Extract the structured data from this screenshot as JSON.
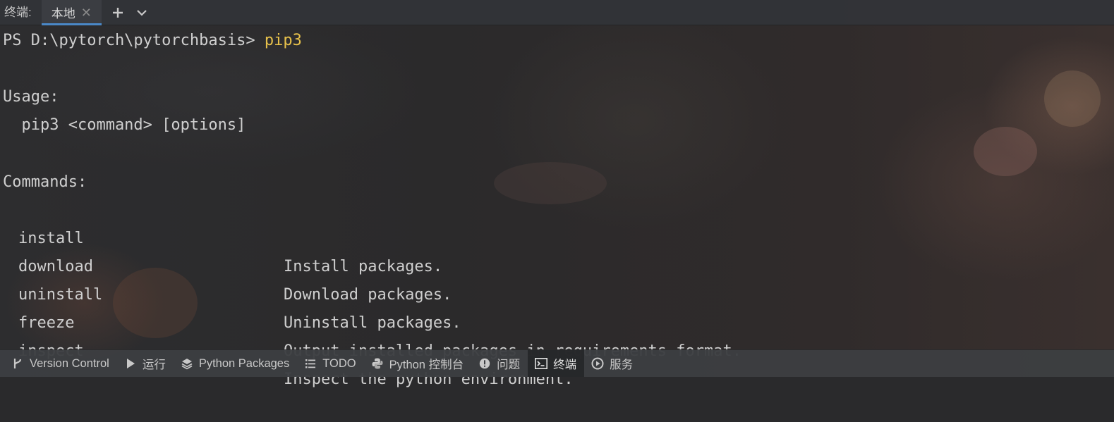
{
  "tabbar": {
    "title": "终端:",
    "tabs": [
      {
        "label": "本地",
        "close_glyph": "✕"
      }
    ],
    "add_icon": "plus-icon",
    "dropdown_icon": "chevron-down-icon"
  },
  "terminal": {
    "prompt": "PS D:\\pytorch\\pytorchbasis> ",
    "typed_command": "pip3",
    "usage_heading": "Usage:",
    "usage_line": "  pip3 <command> [options]",
    "commands_heading": "Commands:",
    "commands": [
      {
        "name": "install",
        "desc": "Install packages."
      },
      {
        "name": "download",
        "desc": "Download packages."
      },
      {
        "name": "uninstall",
        "desc": "Uninstall packages."
      },
      {
        "name": "freeze",
        "desc": "Output installed packages in requirements format."
      },
      {
        "name": "inspect",
        "desc": "Inspect the python environment."
      }
    ]
  },
  "bottombar": {
    "items": [
      {
        "label": "Version Control",
        "icon": "branch-icon"
      },
      {
        "label": "运行",
        "icon": "run-icon"
      },
      {
        "label": "Python Packages",
        "icon": "layers-icon"
      },
      {
        "label": "TODO",
        "icon": "list-icon"
      },
      {
        "label": "Python 控制台",
        "icon": "python-icon"
      },
      {
        "label": "问题",
        "icon": "warning-icon"
      },
      {
        "label": "终端",
        "icon": "terminal-icon",
        "active": true
      },
      {
        "label": "服务",
        "icon": "services-icon"
      }
    ]
  },
  "colors": {
    "command_highlight": "#e7c14b",
    "tab_underline": "#4a88c7",
    "text": "#cfcfcf"
  }
}
